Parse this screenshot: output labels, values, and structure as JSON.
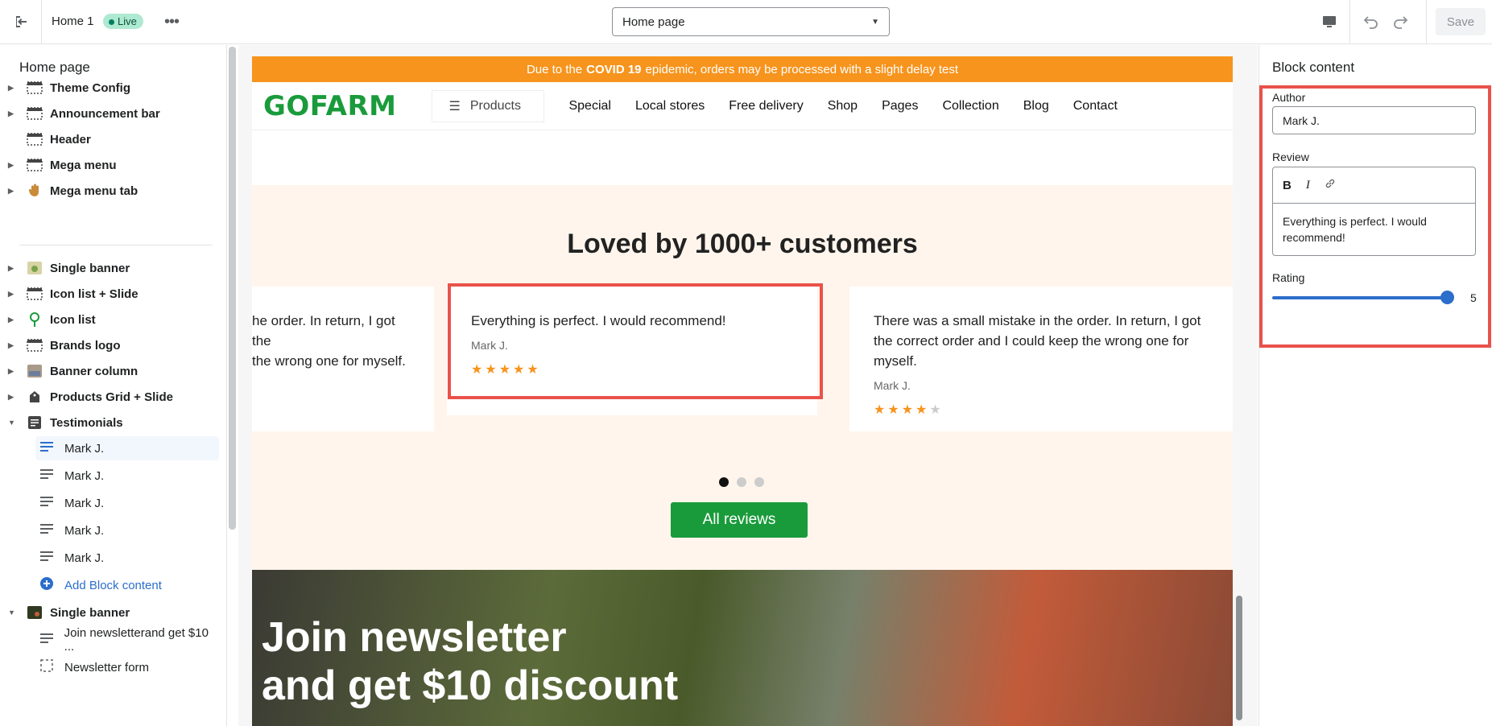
{
  "topbar": {
    "theme_name": "Home 1",
    "status": "Live",
    "page_selector": "Home page",
    "save_label": "Save"
  },
  "sidebar": {
    "title": "Home page",
    "sections": [
      {
        "label": "Theme Config"
      },
      {
        "label": "Announcement bar"
      },
      {
        "label": "Header"
      },
      {
        "label": "Mega menu"
      },
      {
        "label": "Mega menu tab"
      },
      {
        "label": "Single banner"
      },
      {
        "label": "Icon list + Slide"
      },
      {
        "label": "Icon list"
      },
      {
        "label": "Brands logo"
      },
      {
        "label": "Banner column"
      },
      {
        "label": "Products Grid + Slide"
      },
      {
        "label": "Testimonials"
      }
    ],
    "testimonial_blocks": [
      "Mark J.",
      "Mark J.",
      "Mark J.",
      "Mark J.",
      "Mark J."
    ],
    "add_block": "Add Block content",
    "single_banner": "Single banner",
    "single_banner_blocks": [
      "Join newsletterand get $10 ...",
      "Newsletter form"
    ]
  },
  "site": {
    "announcement_pre": "Due to the",
    "announcement_bold": "COVID 19",
    "announcement_post": "epidemic, orders may be processed with a slight delay test",
    "logo": "GOFARM",
    "products_btn": "Products",
    "nav": [
      "Special",
      "Local stores",
      "Free delivery",
      "Shop",
      "Pages",
      "Collection",
      "Blog",
      "Contact"
    ],
    "testimonials_title": "Loved by 1000+ customers",
    "card_left_text": "he order. In return, I got the\n the wrong one for myself.",
    "card_mid_text": "Everything is perfect. I would recommend!",
    "card_mid_author": "Mark J.",
    "card_mid_rating": 5,
    "card_right_text": "There was a small mistake in the order. In return, I got the correct order and I could keep the wrong one for myself.",
    "card_right_author": "Mark J.",
    "card_right_rating": 4,
    "all_reviews": "All reviews",
    "banner_line1": "Join newsletter",
    "banner_line2": "and get $10 discount"
  },
  "panel": {
    "title": "Block content",
    "author_label": "Author",
    "author_value": "Mark J.",
    "review_label": "Review",
    "review_value": "Everything is perfect. I would recommend!",
    "rating_label": "Rating",
    "rating_value": "5"
  },
  "colors": {
    "accent": "#2c6ecb",
    "brand_green": "#1a9b3b",
    "announce_orange": "#f7941d",
    "highlight_red": "#e8524a"
  }
}
